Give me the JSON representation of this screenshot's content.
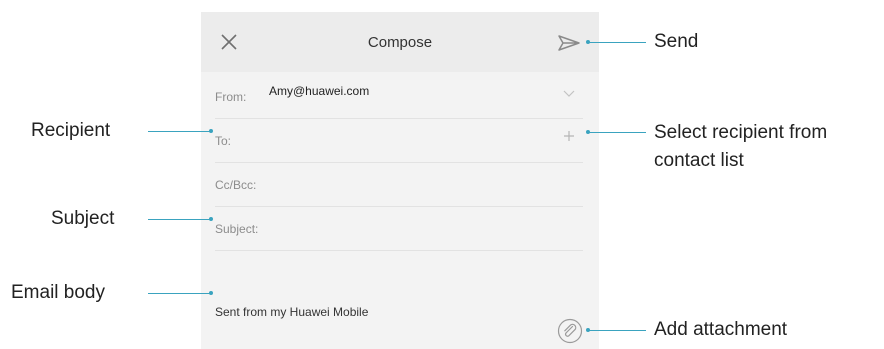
{
  "toolbar": {
    "title": "Compose",
    "close_icon": "close-icon",
    "send_icon": "send-icon"
  },
  "form": {
    "from_label": "From:",
    "from_value": "Amy@huawei.com",
    "to_label": "To:",
    "ccbcc_label": "Cc/Bcc:",
    "subject_label": "Subject:",
    "signature": "Sent from my Huawei Mobile"
  },
  "callouts": {
    "send": "Send",
    "recipient": "Recipient",
    "select_recipient_line1": "Select recipient from",
    "select_recipient_line2": "contact list",
    "subject": "Subject",
    "email_body": "Email body",
    "add_attachment": "Add attachment"
  },
  "colors": {
    "callout_line": "#3aa3bf",
    "screen_bg": "#f3f3f3",
    "toolbar_bg": "#ececec"
  }
}
